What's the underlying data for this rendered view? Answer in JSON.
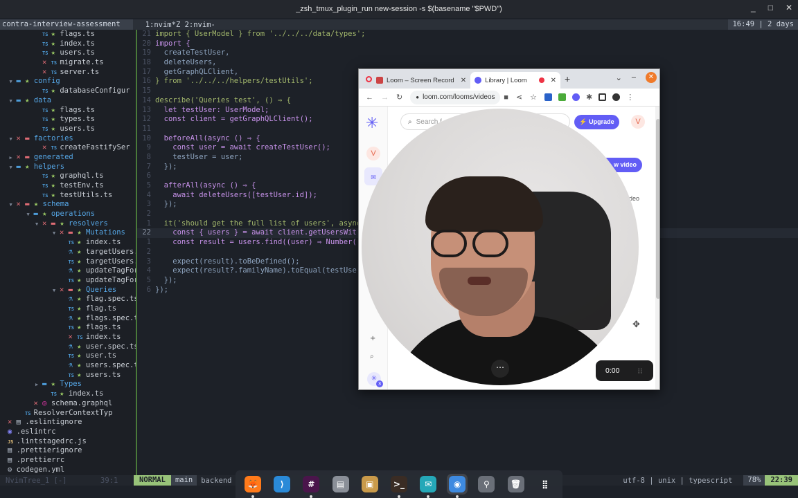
{
  "window": {
    "title": "_zsh_tmux_plugin_run new-session -s $(basename \"$PWD\")",
    "min": "_",
    "max": "□",
    "close": "✕"
  },
  "tmux": {
    "session": "contra-interview-assessment",
    "windows": "1:nvim*Z 2:nvim-",
    "right": "16:49 | 2 days"
  },
  "tree": [
    {
      "indent": 6,
      "glyph": "",
      "icon": "TS",
      "star": true,
      "x": false,
      "name": "flags.ts",
      "dir": false
    },
    {
      "indent": 6,
      "glyph": "",
      "icon": "TS",
      "star": true,
      "x": false,
      "name": "index.ts",
      "dir": false
    },
    {
      "indent": 6,
      "glyph": "",
      "icon": "TS",
      "star": true,
      "x": false,
      "name": "users.ts",
      "dir": false
    },
    {
      "indent": 6,
      "glyph": "",
      "icon": "TS",
      "star": false,
      "x": true,
      "name": "migrate.ts",
      "dir": false
    },
    {
      "indent": 6,
      "glyph": "",
      "icon": "TS",
      "star": false,
      "x": true,
      "name": "server.ts",
      "dir": false
    },
    {
      "indent": 3,
      "glyph": "▼",
      "icon": "dir",
      "star": true,
      "x": false,
      "name": "config",
      "dir": true
    },
    {
      "indent": 6,
      "glyph": "",
      "icon": "TS",
      "star": true,
      "x": false,
      "name": "databaseConfigur",
      "dir": false
    },
    {
      "indent": 3,
      "glyph": "▼",
      "icon": "dir",
      "star": true,
      "x": false,
      "name": "data",
      "dir": true
    },
    {
      "indent": 6,
      "glyph": "",
      "icon": "TS",
      "star": true,
      "x": false,
      "name": "flags.ts",
      "dir": false
    },
    {
      "indent": 6,
      "glyph": "",
      "icon": "TS",
      "star": true,
      "x": false,
      "name": "types.ts",
      "dir": false
    },
    {
      "indent": 6,
      "glyph": "",
      "icon": "TS",
      "star": true,
      "x": false,
      "name": "users.ts",
      "dir": false
    },
    {
      "indent": 3,
      "glyph": "▼",
      "icon": "dir",
      "star": false,
      "x": true,
      "name": "factories",
      "dir": true
    },
    {
      "indent": 6,
      "glyph": "",
      "icon": "TS",
      "star": false,
      "x": true,
      "name": "createFastifySer",
      "dir": false
    },
    {
      "indent": 3,
      "glyph": "▶",
      "icon": "dir",
      "star": false,
      "x": true,
      "name": "generated",
      "dir": true
    },
    {
      "indent": 3,
      "glyph": "▼",
      "icon": "dir",
      "star": true,
      "x": false,
      "name": "helpers",
      "dir": true
    },
    {
      "indent": 6,
      "glyph": "",
      "icon": "TS",
      "star": true,
      "x": false,
      "name": "graphql.ts",
      "dir": false
    },
    {
      "indent": 6,
      "glyph": "",
      "icon": "TS",
      "star": true,
      "x": false,
      "name": "testEnv.ts",
      "dir": false
    },
    {
      "indent": 6,
      "glyph": "",
      "icon": "TS",
      "star": true,
      "x": false,
      "name": "testUtils.ts",
      "dir": false
    },
    {
      "indent": 3,
      "glyph": "▼",
      "icon": "dir",
      "star": true,
      "x": true,
      "name": "schema",
      "dir": true
    },
    {
      "indent": 5,
      "glyph": "▼",
      "icon": "dir",
      "star": true,
      "x": false,
      "name": "operations",
      "dir": true
    },
    {
      "indent": 6,
      "glyph": "▼",
      "icon": "dir",
      "star": true,
      "x": true,
      "name": "resolvers",
      "dir": true
    },
    {
      "indent": 8,
      "glyph": "▼",
      "icon": "dir",
      "star": true,
      "x": true,
      "name": "Mutations",
      "dir": true
    },
    {
      "indent": 9,
      "glyph": "",
      "icon": "TS",
      "star": true,
      "x": false,
      "name": "index.ts",
      "dir": false
    },
    {
      "indent": 9,
      "glyph": "",
      "icon": "test",
      "star": true,
      "x": false,
      "name": "targetUsers.",
      "dir": false
    },
    {
      "indent": 9,
      "glyph": "",
      "icon": "TS",
      "star": true,
      "x": false,
      "name": "targetUsers.",
      "dir": false
    },
    {
      "indent": 9,
      "glyph": "",
      "icon": "test",
      "star": true,
      "x": false,
      "name": "updateTagFor",
      "dir": false
    },
    {
      "indent": 9,
      "glyph": "",
      "icon": "TS",
      "star": true,
      "x": false,
      "name": "updateTagFor",
      "dir": false
    },
    {
      "indent": 8,
      "glyph": "▼",
      "icon": "dir",
      "star": true,
      "x": true,
      "name": "Queries",
      "dir": true
    },
    {
      "indent": 9,
      "glyph": "",
      "icon": "test",
      "star": true,
      "x": false,
      "name": "flag.spec.ts",
      "dir": false
    },
    {
      "indent": 9,
      "glyph": "",
      "icon": "TS",
      "star": true,
      "x": false,
      "name": "flag.ts",
      "dir": false
    },
    {
      "indent": 9,
      "glyph": "",
      "icon": "test",
      "star": true,
      "x": false,
      "name": "flags.spec.t",
      "dir": false
    },
    {
      "indent": 9,
      "glyph": "",
      "icon": "TS",
      "star": true,
      "x": false,
      "name": "flags.ts",
      "dir": false
    },
    {
      "indent": 9,
      "glyph": "",
      "icon": "TS",
      "star": false,
      "x": true,
      "name": "index.ts",
      "dir": false
    },
    {
      "indent": 9,
      "glyph": "",
      "icon": "test",
      "star": true,
      "x": false,
      "name": "user.spec.ts",
      "dir": false
    },
    {
      "indent": 9,
      "glyph": "",
      "icon": "TS",
      "star": true,
      "x": false,
      "name": "user.ts",
      "dir": false
    },
    {
      "indent": 9,
      "glyph": "",
      "icon": "test",
      "star": true,
      "x": false,
      "name": "users.spec.t",
      "dir": false
    },
    {
      "indent": 9,
      "glyph": "",
      "icon": "TS",
      "star": true,
      "x": false,
      "name": "users.ts",
      "dir": false
    },
    {
      "indent": 6,
      "glyph": "▶",
      "icon": "dir",
      "star": true,
      "x": false,
      "name": "Types",
      "dir": true
    },
    {
      "indent": 7,
      "glyph": "",
      "icon": "TS",
      "star": true,
      "x": false,
      "name": "index.ts",
      "dir": false
    },
    {
      "indent": 5,
      "glyph": "",
      "icon": "gql",
      "star": false,
      "x": true,
      "name": "schema.graphql",
      "dir": false
    },
    {
      "indent": 4,
      "glyph": "",
      "icon": "TS",
      "star": false,
      "x": false,
      "name": "ResolverContextTyp",
      "dir": false
    },
    {
      "indent": 2,
      "glyph": "",
      "icon": "file",
      "star": false,
      "x": true,
      "name": ".eslintignore",
      "dir": false
    },
    {
      "indent": 2,
      "glyph": "",
      "icon": "eslint",
      "star": false,
      "x": false,
      "name": ".eslintrc",
      "dir": false
    },
    {
      "indent": 2,
      "glyph": "",
      "icon": "JS",
      "star": false,
      "x": false,
      "name": ".lintstagedrc.js",
      "dir": false
    },
    {
      "indent": 2,
      "glyph": "",
      "icon": "file",
      "star": false,
      "x": false,
      "name": ".prettierignore",
      "dir": false
    },
    {
      "indent": 2,
      "glyph": "",
      "icon": "file",
      "star": false,
      "x": false,
      "name": ".prettierrc",
      "dir": false
    },
    {
      "indent": 2,
      "glyph": "",
      "icon": "gear",
      "star": false,
      "x": false,
      "name": "codegen.yml",
      "dir": false
    }
  ],
  "code": [
    {
      "ln": "21",
      "text": "import { UserModel } from '../../../data/types';"
    },
    {
      "ln": "20",
      "text": "import {"
    },
    {
      "ln": "19",
      "text": "  createTestUser,"
    },
    {
      "ln": "18",
      "text": "  deleteUsers,"
    },
    {
      "ln": "17",
      "text": "  getGraphQLClient,"
    },
    {
      "ln": "16",
      "text": "} from '../../../helpers/testUtils';"
    },
    {
      "ln": "15",
      "text": ""
    },
    {
      "ln": "14",
      "text": "describe('Queries test', () ⇒ {"
    },
    {
      "ln": "13",
      "text": "  let testUser: UserModel;"
    },
    {
      "ln": "12",
      "text": "  const client = getGraphQLClient();"
    },
    {
      "ln": "11",
      "text": ""
    },
    {
      "ln": "10",
      "text": "  beforeAll(async () ⇒ {"
    },
    {
      "ln": "9",
      "text": "    const user = await createTestUser();"
    },
    {
      "ln": "8",
      "text": "    testUser = user;"
    },
    {
      "ln": "7",
      "text": "  });"
    },
    {
      "ln": "6",
      "text": ""
    },
    {
      "ln": "5",
      "text": "  afterAll(async () ⇒ {"
    },
    {
      "ln": "4",
      "text": "    await deleteUsers([testUser.id]);"
    },
    {
      "ln": "3",
      "text": "  });"
    },
    {
      "ln": "2",
      "text": ""
    },
    {
      "ln": "1",
      "text": "  it('should get the full list of users', async"
    },
    {
      "ln": "22",
      "text": "    const { users } = await client.getUsersWit"
    },
    {
      "ln": "1",
      "text": "    const result = users.find((user) ⇒ Number("
    },
    {
      "ln": "2",
      "text": ""
    },
    {
      "ln": "3",
      "text": "    expect(result).toBeDefined();"
    },
    {
      "ln": "4",
      "text": "    expect(result?.familyName).toEqual(testUse"
    },
    {
      "ln": "5",
      "text": "  });"
    },
    {
      "ln": "6",
      "text": "});"
    }
  ],
  "status": {
    "left": "NvimTree_1 [-]",
    "pos": "39:1",
    "mode": "NORMAL",
    "branch": "main",
    "file": "backend",
    "encoding": "utf-8 | unix | typescript",
    "percent": "78%",
    "time": "22:39"
  },
  "dock": [
    {
      "name": "firefox",
      "label": "🦊",
      "color": "#ff7a1a",
      "dot": true,
      "active": false
    },
    {
      "name": "vscode",
      "label": "⟩",
      "color": "#2a8ad8",
      "dot": false,
      "active": false
    },
    {
      "name": "slack",
      "label": "#",
      "color": "#4a154b",
      "dot": true,
      "active": false
    },
    {
      "name": "files",
      "label": "▤",
      "color": "#8a8f98",
      "dot": false,
      "active": false
    },
    {
      "name": "archive",
      "label": "▣",
      "color": "#c99a4a",
      "dot": false,
      "active": false
    },
    {
      "name": "terminal",
      "label": ">_",
      "color": "#3a2c24",
      "dot": true,
      "active": false
    },
    {
      "name": "mail",
      "label": "✉",
      "color": "#25a8b8",
      "dot": true,
      "active": false
    },
    {
      "name": "chrome",
      "label": "◉",
      "color": "#3e8ae0",
      "dot": true,
      "active": true
    },
    {
      "name": "usb",
      "label": "⚲",
      "color": "#6a6f78",
      "dot": false,
      "active": false
    },
    {
      "name": "trash",
      "label": "🗑",
      "color": "#6a6f78",
      "dot": false,
      "active": false
    },
    {
      "name": "app-grid",
      "label": "⣿",
      "color": "transparent",
      "dot": false,
      "active": false
    }
  ],
  "browser": {
    "tab1": "Loom – Screen Record",
    "tab2": "Library | Loom",
    "url": "loom.com/looms/videos",
    "search_placeholder": "Search f",
    "upgrade": "Upgrade",
    "avatar": "V",
    "new_video": "w video",
    "side_text": "ideo",
    "ext_badge": "3"
  },
  "recording": {
    "timer": "0:00",
    "more": "⋯"
  }
}
